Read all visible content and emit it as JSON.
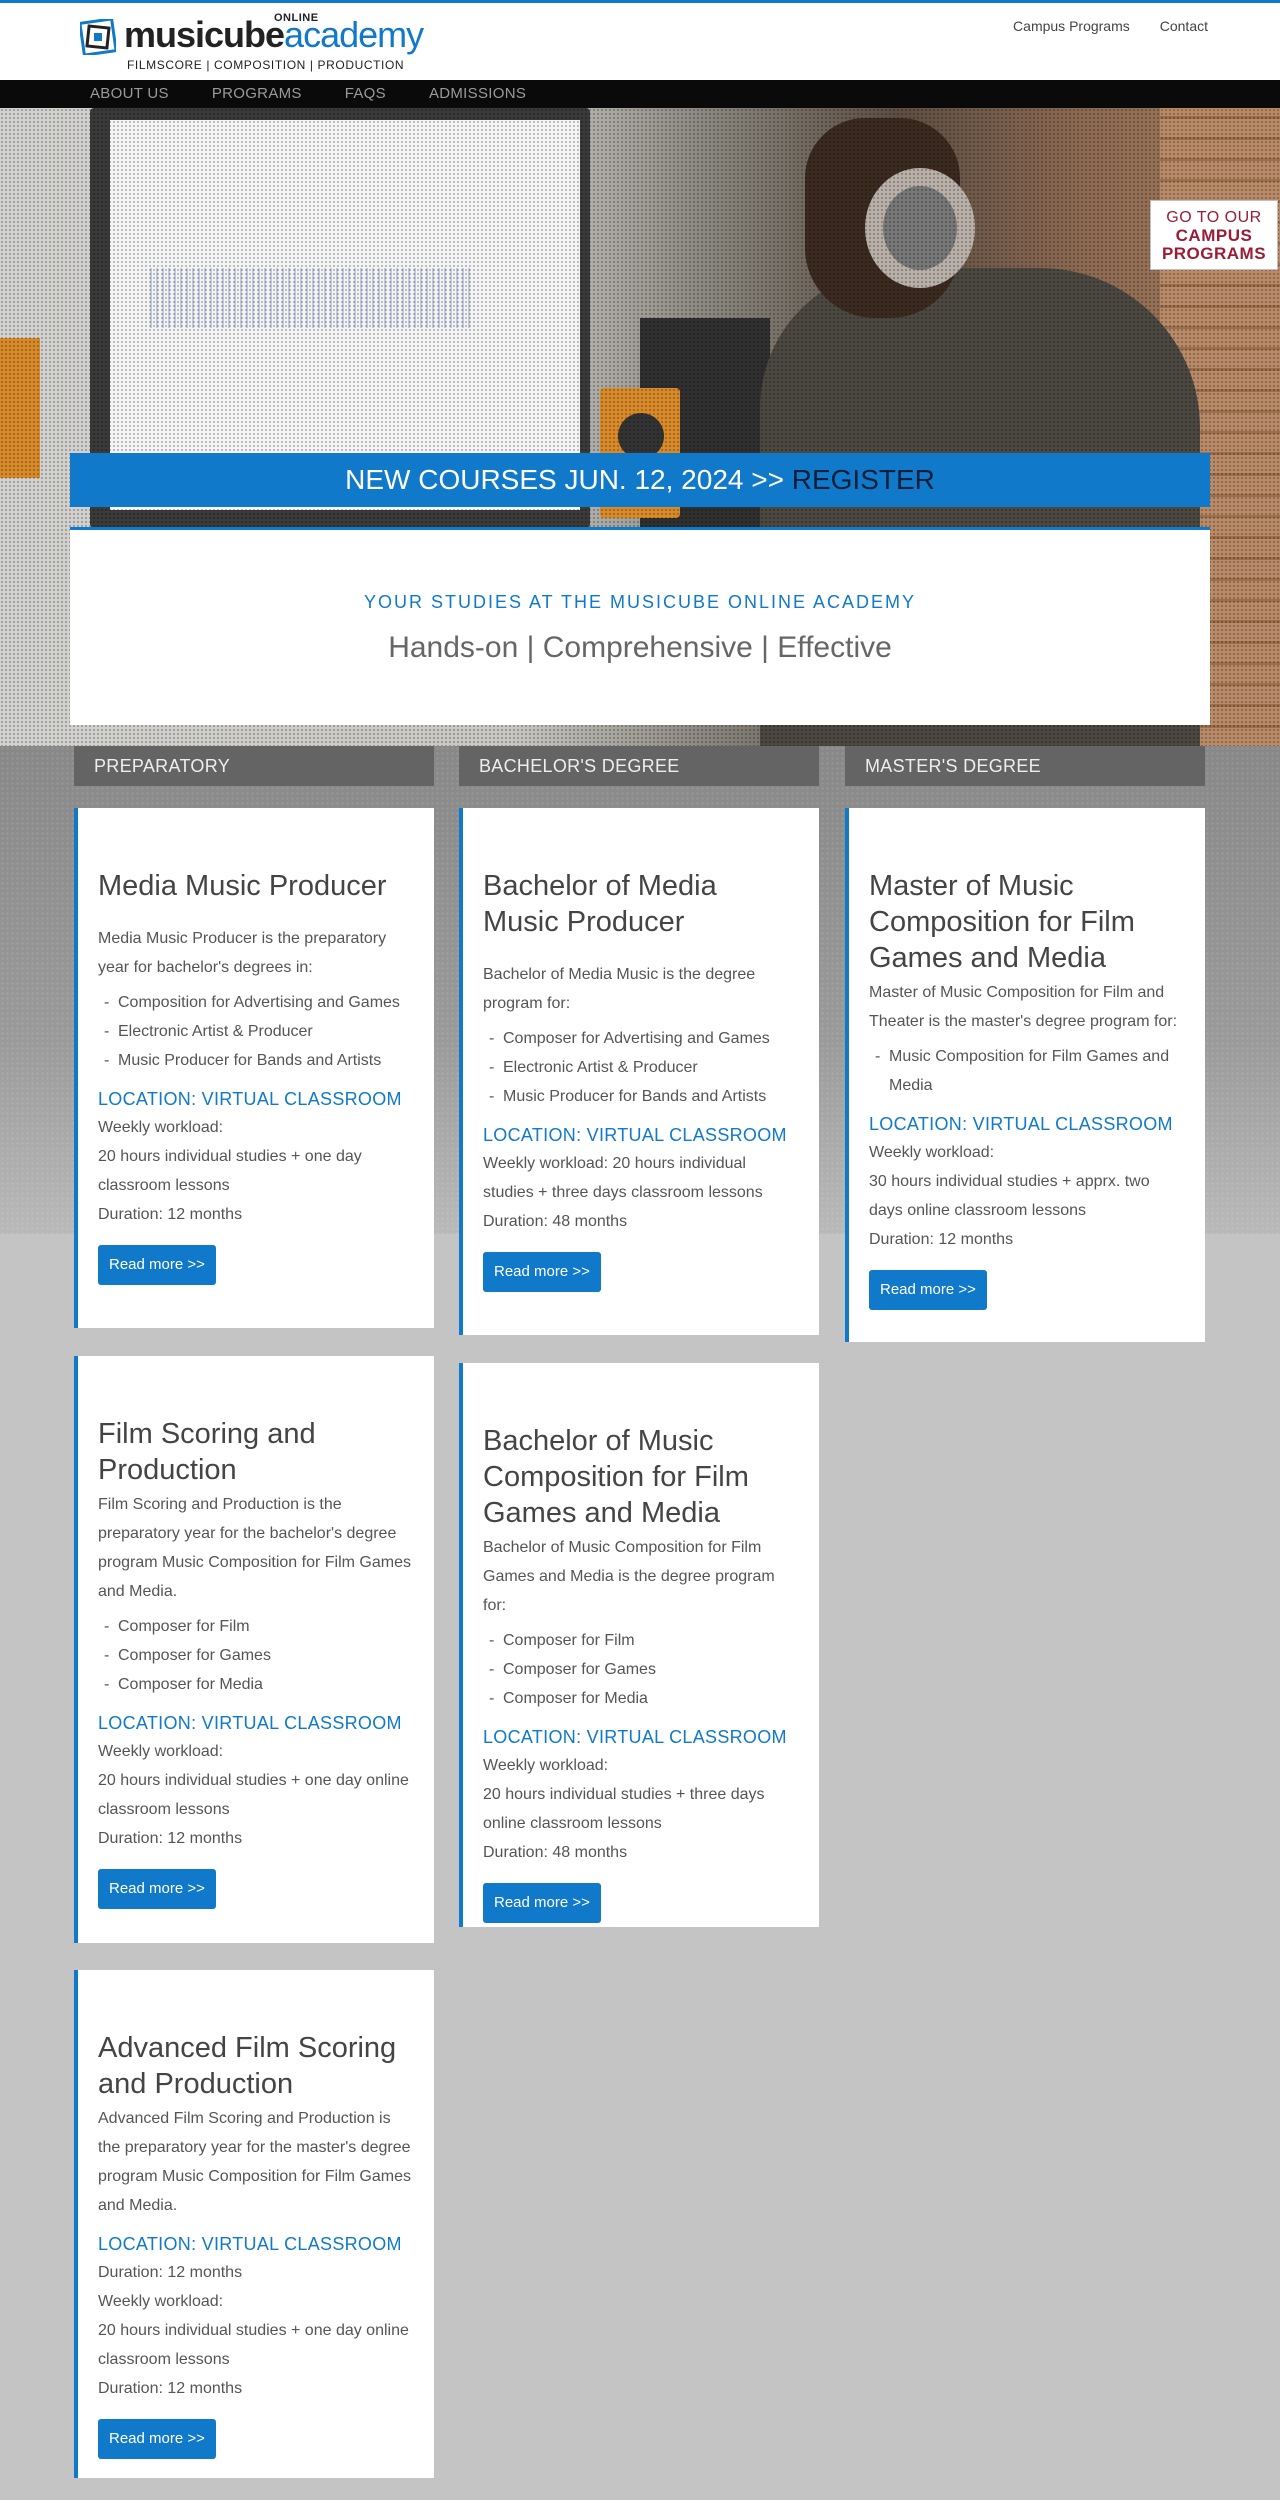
{
  "brand": {
    "online": "ONLINE",
    "name_bold": "musicube",
    "name_light": "academy",
    "tagline": "FILMSCORE | COMPOSITION | PRODUCTION"
  },
  "top_nav": {
    "campus": "Campus Programs",
    "contact": "Contact"
  },
  "main_nav": [
    "ABOUT US",
    "PROGRAMS",
    "FAQS",
    "ADMISSIONS"
  ],
  "campus_badge": {
    "line1": "GO TO OUR",
    "line2": "CAMPUS",
    "line3": "PROGRAMS"
  },
  "register_bar": {
    "text": "NEW COURSES JUN. 12, 2024 >> ",
    "cta": "REGISTER"
  },
  "intro": {
    "kicker": "YOUR STUDIES AT THE MUSICUBE ONLINE ACADEMY",
    "tagline": "Hands-on | Comprehensive | Effective"
  },
  "columns": [
    "PREPARATORY",
    "BACHELOR'S DEGREE",
    "MASTER'S DEGREE"
  ],
  "cards": {
    "mmp": {
      "title": "Media Music Producer",
      "desc": "Media Music Producer is the preparatory year for bachelor's degrees in:",
      "items": [
        "Composition for Advertising and Games",
        "Electronic Artist & Producer",
        "Music Producer for Bands and Artists"
      ],
      "location": "LOCATION: VIRTUAL CLASSROOM",
      "lines": [
        "Weekly workload:",
        "20 hours individual studies + one day classroom lessons",
        "Duration: 12 months"
      ],
      "button": "Read more >>"
    },
    "bmmp": {
      "title": "Bachelor of Media Music Producer",
      "desc": "Bachelor of Media Music is the degree program for:",
      "items": [
        "Composer for Advertising and Games",
        "Electronic Artist & Producer",
        "Music Producer for Bands and Artists"
      ],
      "location": "LOCATION: VIRTUAL CLASSROOM",
      "lines": [
        "Weekly workload: 20 hours individual studies + three days classroom lessons",
        "Duration: 48 months"
      ],
      "button": "Read more >>"
    },
    "mmc": {
      "title": "Master of Music Composition for Film Games and Media",
      "desc": "Master of Music Composition for Film and Theater is the master's degree program for:",
      "items": [
        "Music Composition for Film Games and Media"
      ],
      "location": "LOCATION: VIRTUAL CLASSROOM",
      "lines": [
        "Weekly workload:",
        "30 hours individual studies + apprx. two days online classroom lessons",
        "Duration: 12 months"
      ],
      "button": "Read more >>"
    },
    "fsp": {
      "title": "Film Scoring and Production",
      "desc": "Film Scoring and Production is the preparatory year for the bachelor's degree program Music Composition for Film Games and Media.",
      "items": [
        "Composer for Film",
        "Composer for Games",
        "Composer for Media"
      ],
      "location": "LOCATION: VIRTUAL CLASSROOM",
      "lines": [
        "Weekly workload:",
        "20 hours individual studies + one day online classroom lessons",
        "Duration: 12 months"
      ],
      "button": "Read more >>"
    },
    "bmc": {
      "title": "Bachelor of Music Composition for Film Games and Media",
      "desc": "Bachelor of Music Composition for Film Games and Media is the degree program for:",
      "items": [
        "Composer for Film",
        "Composer for Games",
        "Composer for Media"
      ],
      "location": "LOCATION: VIRTUAL CLASSROOM",
      "lines": [
        "Weekly workload:",
        "20 hours individual studies + three days online classroom lessons",
        "Duration: 48 months"
      ],
      "button": "Read more >>"
    },
    "afsp": {
      "title": "Advanced Film Scoring and Production",
      "desc": "Advanced Film Scoring and Production is the preparatory year for the master's degree program Music Composition for Film Games and Media.",
      "location": "LOCATION: VIRTUAL CLASSROOM",
      "lines": [
        "Duration: 12 months",
        "Weekly workload:",
        "20 hours individual studies + one day online classroom lessons",
        "Duration: 12 months"
      ],
      "button": "Read more >>"
    }
  }
}
